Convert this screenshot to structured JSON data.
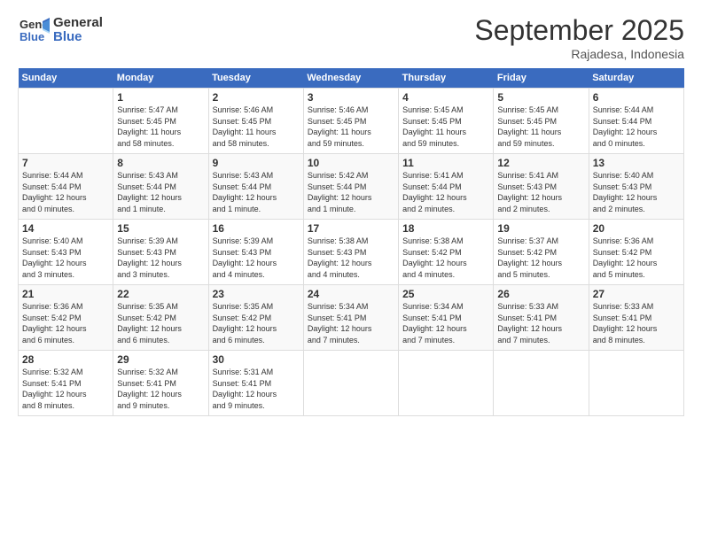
{
  "logo": {
    "line1": "General",
    "line2": "Blue"
  },
  "title": "September 2025",
  "subtitle": "Rajadesa, Indonesia",
  "days_header": [
    "Sunday",
    "Monday",
    "Tuesday",
    "Wednesday",
    "Thursday",
    "Friday",
    "Saturday"
  ],
  "weeks": [
    [
      {
        "num": "",
        "info": ""
      },
      {
        "num": "1",
        "info": "Sunrise: 5:47 AM\nSunset: 5:45 PM\nDaylight: 11 hours\nand 58 minutes."
      },
      {
        "num": "2",
        "info": "Sunrise: 5:46 AM\nSunset: 5:45 PM\nDaylight: 11 hours\nand 58 minutes."
      },
      {
        "num": "3",
        "info": "Sunrise: 5:46 AM\nSunset: 5:45 PM\nDaylight: 11 hours\nand 59 minutes."
      },
      {
        "num": "4",
        "info": "Sunrise: 5:45 AM\nSunset: 5:45 PM\nDaylight: 11 hours\nand 59 minutes."
      },
      {
        "num": "5",
        "info": "Sunrise: 5:45 AM\nSunset: 5:45 PM\nDaylight: 11 hours\nand 59 minutes."
      },
      {
        "num": "6",
        "info": "Sunrise: 5:44 AM\nSunset: 5:44 PM\nDaylight: 12 hours\nand 0 minutes."
      }
    ],
    [
      {
        "num": "7",
        "info": "Sunrise: 5:44 AM\nSunset: 5:44 PM\nDaylight: 12 hours\nand 0 minutes."
      },
      {
        "num": "8",
        "info": "Sunrise: 5:43 AM\nSunset: 5:44 PM\nDaylight: 12 hours\nand 1 minute."
      },
      {
        "num": "9",
        "info": "Sunrise: 5:43 AM\nSunset: 5:44 PM\nDaylight: 12 hours\nand 1 minute."
      },
      {
        "num": "10",
        "info": "Sunrise: 5:42 AM\nSunset: 5:44 PM\nDaylight: 12 hours\nand 1 minute."
      },
      {
        "num": "11",
        "info": "Sunrise: 5:41 AM\nSunset: 5:44 PM\nDaylight: 12 hours\nand 2 minutes."
      },
      {
        "num": "12",
        "info": "Sunrise: 5:41 AM\nSunset: 5:43 PM\nDaylight: 12 hours\nand 2 minutes."
      },
      {
        "num": "13",
        "info": "Sunrise: 5:40 AM\nSunset: 5:43 PM\nDaylight: 12 hours\nand 2 minutes."
      }
    ],
    [
      {
        "num": "14",
        "info": "Sunrise: 5:40 AM\nSunset: 5:43 PM\nDaylight: 12 hours\nand 3 minutes."
      },
      {
        "num": "15",
        "info": "Sunrise: 5:39 AM\nSunset: 5:43 PM\nDaylight: 12 hours\nand 3 minutes."
      },
      {
        "num": "16",
        "info": "Sunrise: 5:39 AM\nSunset: 5:43 PM\nDaylight: 12 hours\nand 4 minutes."
      },
      {
        "num": "17",
        "info": "Sunrise: 5:38 AM\nSunset: 5:43 PM\nDaylight: 12 hours\nand 4 minutes."
      },
      {
        "num": "18",
        "info": "Sunrise: 5:38 AM\nSunset: 5:42 PM\nDaylight: 12 hours\nand 4 minutes."
      },
      {
        "num": "19",
        "info": "Sunrise: 5:37 AM\nSunset: 5:42 PM\nDaylight: 12 hours\nand 5 minutes."
      },
      {
        "num": "20",
        "info": "Sunrise: 5:36 AM\nSunset: 5:42 PM\nDaylight: 12 hours\nand 5 minutes."
      }
    ],
    [
      {
        "num": "21",
        "info": "Sunrise: 5:36 AM\nSunset: 5:42 PM\nDaylight: 12 hours\nand 6 minutes."
      },
      {
        "num": "22",
        "info": "Sunrise: 5:35 AM\nSunset: 5:42 PM\nDaylight: 12 hours\nand 6 minutes."
      },
      {
        "num": "23",
        "info": "Sunrise: 5:35 AM\nSunset: 5:42 PM\nDaylight: 12 hours\nand 6 minutes."
      },
      {
        "num": "24",
        "info": "Sunrise: 5:34 AM\nSunset: 5:41 PM\nDaylight: 12 hours\nand 7 minutes."
      },
      {
        "num": "25",
        "info": "Sunrise: 5:34 AM\nSunset: 5:41 PM\nDaylight: 12 hours\nand 7 minutes."
      },
      {
        "num": "26",
        "info": "Sunrise: 5:33 AM\nSunset: 5:41 PM\nDaylight: 12 hours\nand 7 minutes."
      },
      {
        "num": "27",
        "info": "Sunrise: 5:33 AM\nSunset: 5:41 PM\nDaylight: 12 hours\nand 8 minutes."
      }
    ],
    [
      {
        "num": "28",
        "info": "Sunrise: 5:32 AM\nSunset: 5:41 PM\nDaylight: 12 hours\nand 8 minutes."
      },
      {
        "num": "29",
        "info": "Sunrise: 5:32 AM\nSunset: 5:41 PM\nDaylight: 12 hours\nand 9 minutes."
      },
      {
        "num": "30",
        "info": "Sunrise: 5:31 AM\nSunset: 5:41 PM\nDaylight: 12 hours\nand 9 minutes."
      },
      {
        "num": "",
        "info": ""
      },
      {
        "num": "",
        "info": ""
      },
      {
        "num": "",
        "info": ""
      },
      {
        "num": "",
        "info": ""
      }
    ]
  ]
}
